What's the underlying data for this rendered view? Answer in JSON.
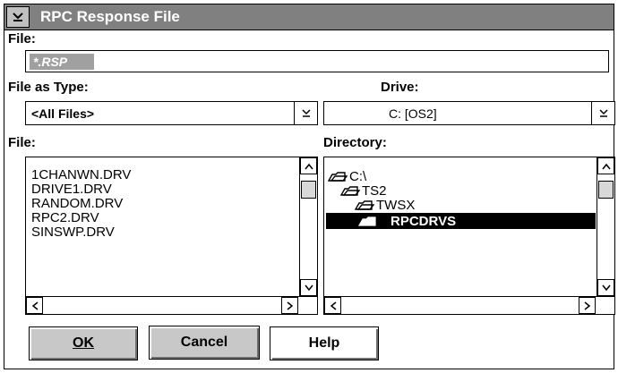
{
  "window": {
    "title": "RPC Response File",
    "sysmenu_icon": "chevron-down-icon"
  },
  "file_field": {
    "label": "File:",
    "value": "*.RSP"
  },
  "file_type": {
    "label": "File as Type:",
    "selected": "<All Files>"
  },
  "drive": {
    "label": "Drive:",
    "selected": "C:  [OS2]"
  },
  "file_list": {
    "label": "File:",
    "items": [
      "1CHANWN.DRV",
      "DRIVE1.DRV",
      "RANDOM.DRV",
      "RPC2.DRV",
      "SINSWP.DRV"
    ]
  },
  "directory": {
    "label": "Directory:",
    "items": [
      {
        "name": "C:\\",
        "icon": "open-folder-icon"
      },
      {
        "name": "TS2",
        "icon": "open-folder-icon"
      },
      {
        "name": "TWSX",
        "icon": "open-folder-icon"
      },
      {
        "name": "RPCDRVS",
        "icon": "folder-icon",
        "selected": true
      }
    ]
  },
  "buttons": {
    "ok": "OK",
    "cancel": "Cancel",
    "help": "Help"
  }
}
